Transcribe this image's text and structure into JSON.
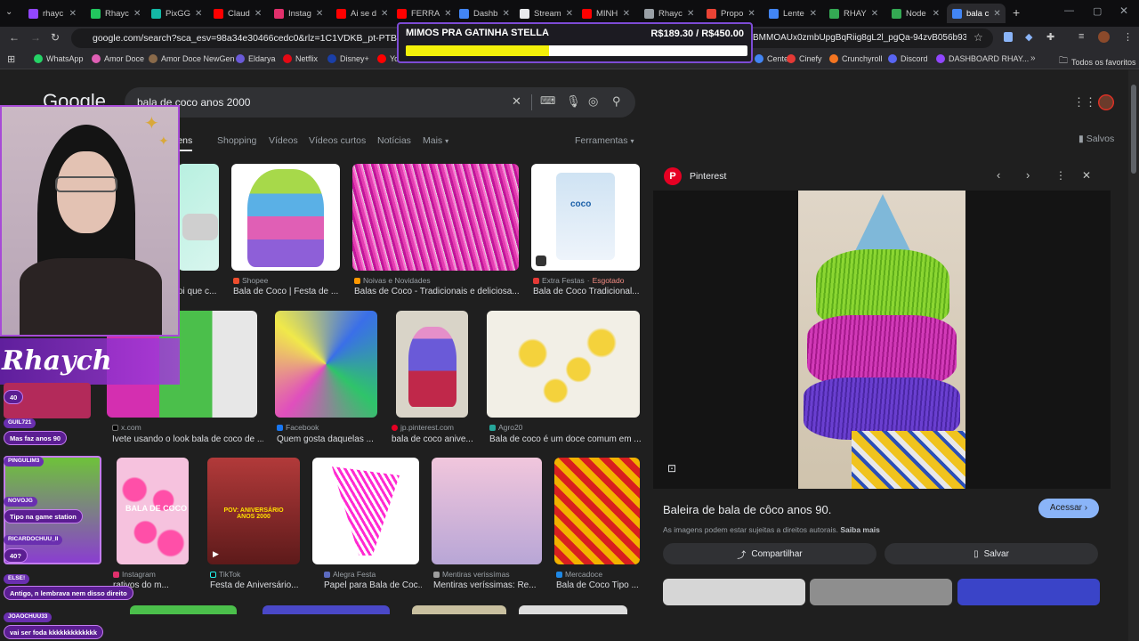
{
  "browser": {
    "tabs": [
      {
        "label": "rhayc",
        "color": "#9146ff"
      },
      {
        "label": "Rhayc",
        "color": "#22c55e"
      },
      {
        "label": "PixGG",
        "color": "#14b8a6"
      },
      {
        "label": "Claud",
        "color": "#ff0000"
      },
      {
        "label": "Instag",
        "color": "#e1306c"
      },
      {
        "label": "Ai se d",
        "color": "#ff0000"
      },
      {
        "label": "FERRA",
        "color": "#ff0000"
      },
      {
        "label": "Dashb",
        "color": "#4285f4"
      },
      {
        "label": "Stream",
        "color": "#e8eaed"
      },
      {
        "label": "MINH",
        "color": "#ff0000"
      },
      {
        "label": "Rhayc",
        "color": "#9aa0a6"
      },
      {
        "label": "Propo",
        "color": "#ea4335"
      },
      {
        "label": "Lente",
        "color": "#4285f4"
      },
      {
        "label": "RHAY",
        "color": "#34a853"
      },
      {
        "label": "Node",
        "color": "#34a853"
      },
      {
        "label": "bala c",
        "color": "#4285f4"
      }
    ],
    "url": "google.com/search?sca_esv=98a34e30466cedc0&rlz=1C1VDKB_pt-PTBR1166BR11",
    "url_tail": "BMMOAUx0zmbUpgBqRiig8gL2l_pgQa-94zvB056b93wK...",
    "bookmarks": [
      "WhatsApp",
      "Amor Doce",
      "Amor Doce NewGen",
      "Eldarya",
      "Netflix",
      "Disney+",
      "Yo"
    ],
    "bookmarks_right": [
      "Center",
      "Cinefy",
      "Crunchyroll",
      "Discord",
      "DASHBOARD RHAY..."
    ],
    "all_favorites": "Todos os favoritos"
  },
  "goal": {
    "title": "MIMOS PRA GATINHA STELLA",
    "amount": "R$189.30 / R$450.00",
    "progress": 0.42
  },
  "google": {
    "logo": "Google",
    "query": "bala de coco anos 2000",
    "filters": [
      "Imagens",
      "Shopping",
      "Vídeos",
      "Vídeos curtos",
      "Notícias",
      "Mais"
    ],
    "tools": "Ferramentas",
    "saved": "Salvos"
  },
  "results": [
    {
      "source": "",
      "caption": "oi que c..."
    },
    {
      "source": "Shopee",
      "caption": "Bala de Coco | Festa de ..."
    },
    {
      "source": "Noivas e Novidades",
      "caption": "Balas de Coco - Tradicionais e deliciosa..."
    },
    {
      "source": "Extra Festas",
      "status": "Esgotado",
      "caption": "Bala de Coco Tradicional..."
    },
    {
      "source": "",
      "caption": ""
    },
    {
      "source": "x.com",
      "caption": "Ivete usando o look bala de coco de ..."
    },
    {
      "source": "Facebook",
      "caption": "Quem gosta daquelas ..."
    },
    {
      "source": "jp.pinterest.com",
      "caption": "bala de coco anive..."
    },
    {
      "source": "Agro20",
      "caption": "Bala de coco é um doce comum em ..."
    },
    {
      "source": "Instagram",
      "caption": "rativos do m..."
    },
    {
      "source": "TikTok",
      "caption": "Festa de Aniversário..."
    },
    {
      "source": "Alegra Festa",
      "caption": "Papel para Bala de Coc..."
    },
    {
      "source": "Mentiras verissímas",
      "caption": "Mentiras veríssimas: Re..."
    },
    {
      "source": "Mercadoce",
      "caption": "Bala de Coco Tipo ..."
    }
  ],
  "thumb_texts": {
    "balacoco": "BALA DE COCO",
    "pov": "POV: ANIVERSÁRIO ANOS 2000",
    "coco_pack": "coco"
  },
  "preview": {
    "source": "Pinterest",
    "title": "Baleira de bala de côco anos 90.",
    "rights": "As imagens podem estar sujeitas a direitos autorais.",
    "learn_more": "Saiba mais",
    "access": "Acessar",
    "share": "Compartilhar",
    "save": "Salvar"
  },
  "stream": {
    "brand": "Rhaych",
    "chat": [
      {
        "name": "",
        "msg": "40"
      },
      {
        "name": "GUIL721",
        "msg": "Mas faz anos 90"
      },
      {
        "name": "PINGULIM3",
        "msg": ""
      },
      {
        "name": "NOVOJG",
        "msg": "Tipo na game station"
      },
      {
        "name": "RICARDOCHUU_II",
        "msg": "40?"
      },
      {
        "name": "ELSE!",
        "msg": "Antigo, n lembrava nem disso direito"
      },
      {
        "name": "JOAOCHUU33",
        "msg": "vai ser foda kkkkkkkkkkkkk"
      }
    ]
  }
}
